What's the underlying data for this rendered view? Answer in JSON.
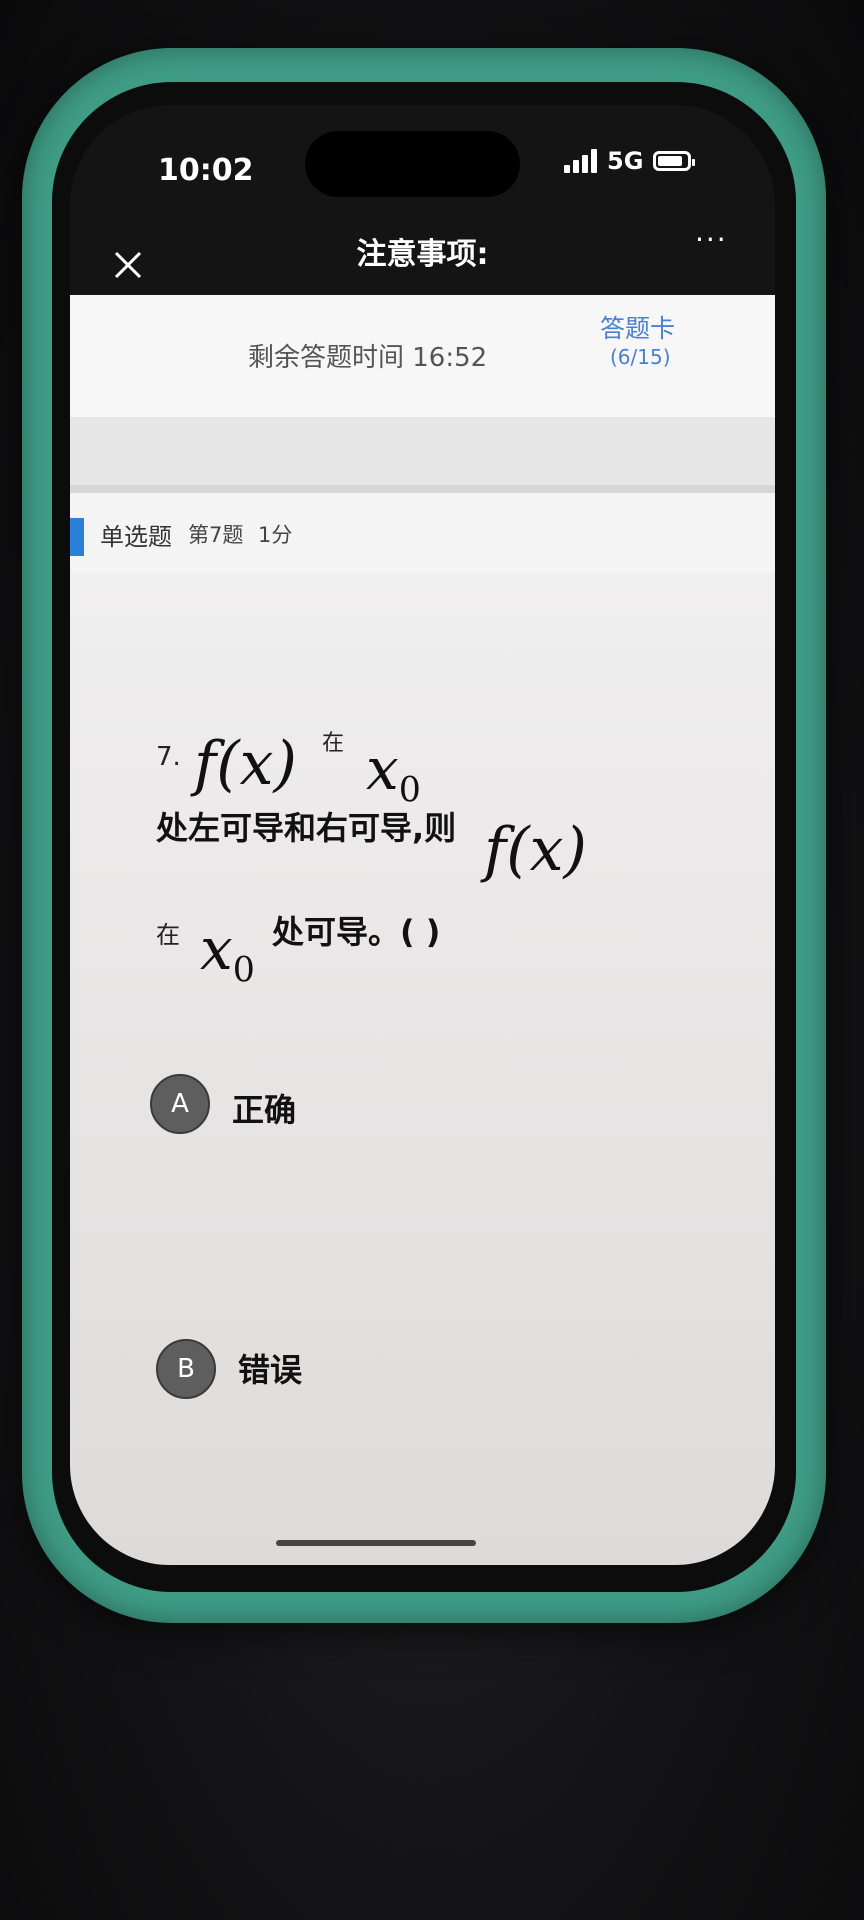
{
  "status": {
    "time": "10:02",
    "network": "5G"
  },
  "nav": {
    "title": "注意事项:",
    "more": "···"
  },
  "exam": {
    "timer_text": "剩余答题时间 16:52",
    "card_link": "答题卡",
    "card_count": "(6/15)"
  },
  "question": {
    "type": "单选题",
    "number_label": "第7题",
    "score": "1分",
    "index": "7.",
    "fx": "f(x)",
    "word_zai": "在",
    "x_var": "x",
    "sub0": "0",
    "line2": "处左可导和右可导,则",
    "line3": "处可导。( )"
  },
  "options": [
    {
      "letter": "A",
      "label": "正确"
    },
    {
      "letter": "B",
      "label": "错误"
    }
  ]
}
